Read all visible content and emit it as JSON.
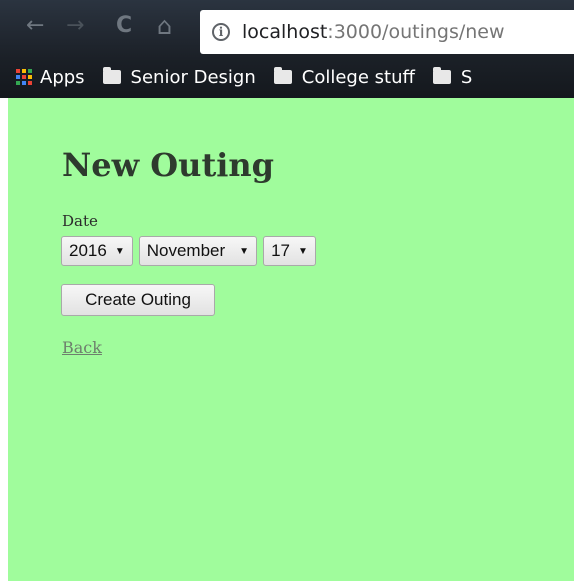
{
  "browser": {
    "url_host": "localhost",
    "url_rest": ":3000/outings/new",
    "info_glyph": "i",
    "back_glyph": "←",
    "forward_glyph": "→",
    "reload_glyph": "C",
    "home_glyph": "⌂",
    "bookmarks": [
      {
        "label": "Apps",
        "icon": "apps-grid-icon"
      },
      {
        "label": "Senior Design",
        "icon": "folder-icon"
      },
      {
        "label": "College stuff",
        "icon": "folder-icon"
      },
      {
        "label": "S",
        "icon": "folder-icon"
      }
    ]
  },
  "page": {
    "background_color": "#a0fc9c",
    "title": "New Outing",
    "date_label": "Date",
    "year_value": "2016",
    "month_value": "November",
    "day_value": "17",
    "dropdown_arrow": "▼",
    "submit_label": "Create Outing",
    "back_label": "Back"
  }
}
